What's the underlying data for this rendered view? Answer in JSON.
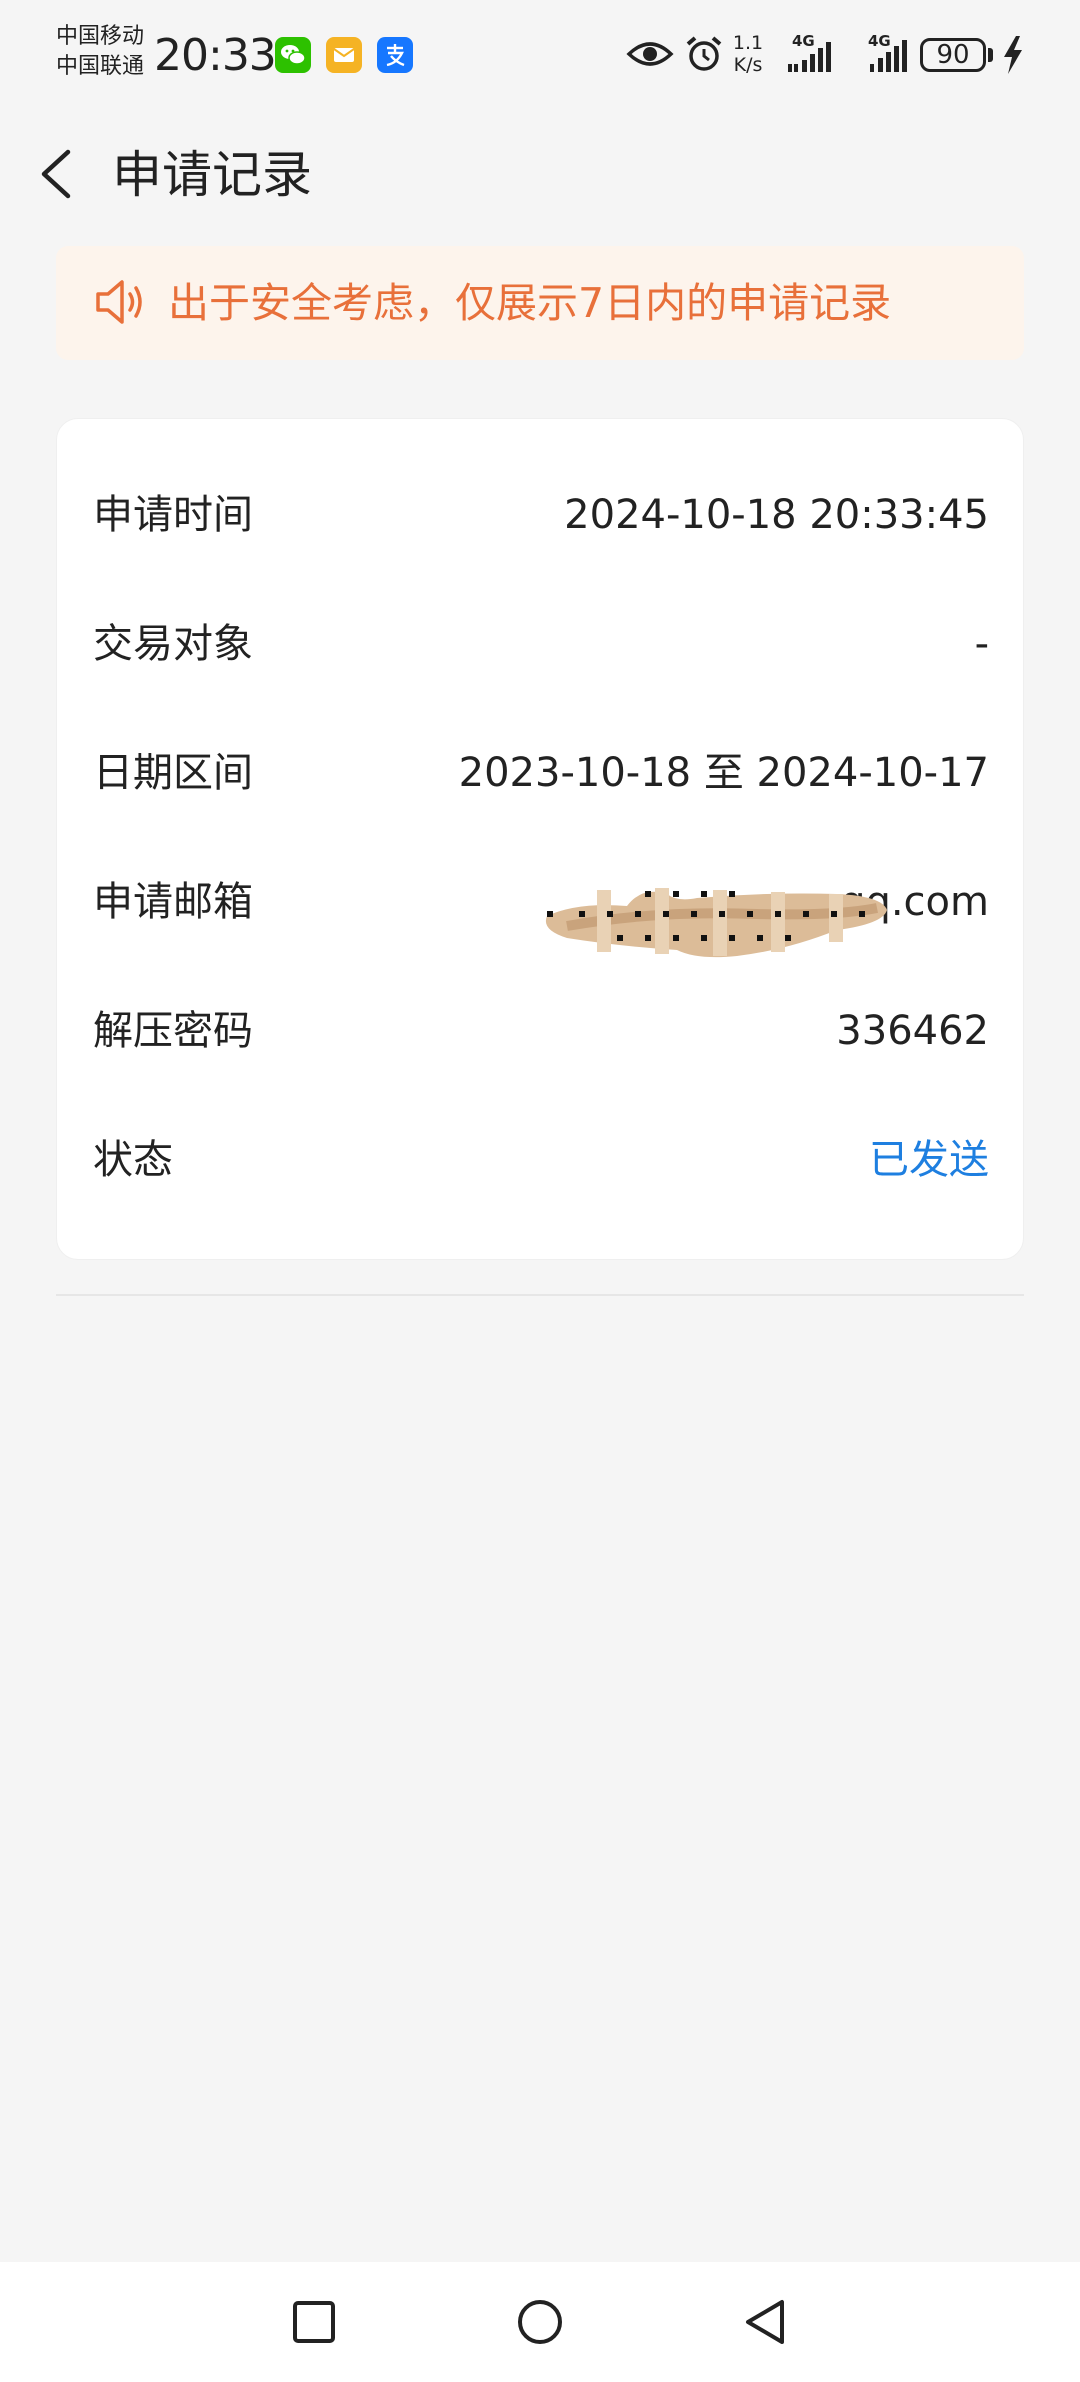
{
  "status_bar": {
    "carrier_1": "中国移动",
    "carrier_2": "中国联通",
    "time": "20:33",
    "net_speed_value": "1.1",
    "net_speed_unit": "K/s",
    "signal_1_label": "4G",
    "signal_2_label": "4G",
    "battery": "90",
    "app_icons": [
      "wechat-icon",
      "mail-icon",
      "alipay-icon"
    ],
    "indicator_icons": [
      "eye-icon",
      "alarm-icon",
      "charging-icon"
    ]
  },
  "header": {
    "title": "申请记录",
    "back_icon": "chevron-left-icon"
  },
  "notice": {
    "icon": "speaker-icon",
    "text": "出于安全考虑，仅展示7日内的申请记录",
    "color": "#e8703a",
    "background": "#fdf4ec"
  },
  "record": {
    "rows": [
      {
        "label": "申请时间",
        "value": "2024-10-18 20:33:45"
      },
      {
        "label": "交易对象",
        "value": "-"
      },
      {
        "label": "日期区间",
        "value": "2023-10-18 至 2024-10-17"
      },
      {
        "label": "申请邮箱",
        "value": "qq.com"
      },
      {
        "label": "解压密码",
        "value": "336462"
      },
      {
        "label": "状态",
        "value": "已发送"
      }
    ],
    "status_color": "#1e7fe0"
  },
  "nav_bar": {
    "buttons": [
      "recent-apps-icon",
      "home-icon",
      "back-icon"
    ]
  }
}
